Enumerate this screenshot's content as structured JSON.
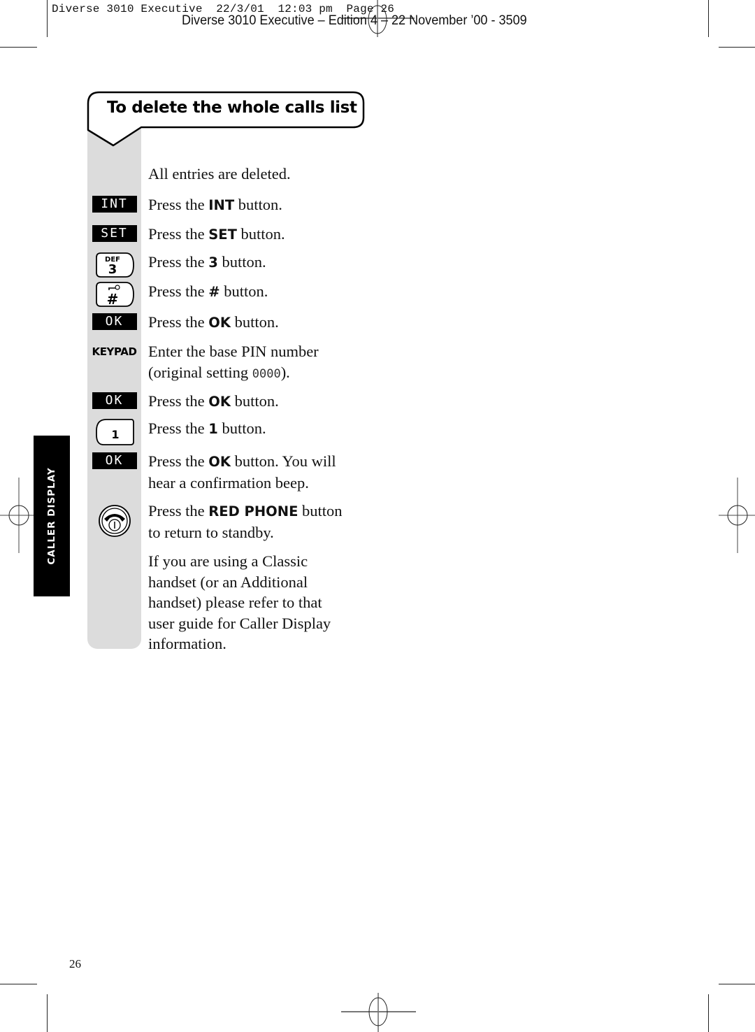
{
  "header": {
    "slug": "Diverse 3010 Executive  22/3/01  12:03 pm  Page 26",
    "edition": "Diverse 3010 Executive – Edition 4 – 22 November ’00 - 3509"
  },
  "section": {
    "title": "To delete the whole calls list",
    "side_tab": "CALLER DISPLAY"
  },
  "steps": [
    {
      "icon": "none",
      "text": "All entries are deleted."
    },
    {
      "icon": "lcd-key",
      "icon_label": "INT",
      "pre": "Press the ",
      "bold": "INT",
      "post": " button."
    },
    {
      "icon": "lcd-key",
      "icon_label": "SET",
      "pre": "Press the ",
      "bold": "SET",
      "post": " button."
    },
    {
      "icon": "keypad-key",
      "icon_label": "3",
      "icon_sub": "DEF",
      "pre": "Press the ",
      "bold": "3",
      "post": " button."
    },
    {
      "icon": "keypad-key",
      "icon_label": "#",
      "icon_sub": "key",
      "pre": "Press the ",
      "bold": "#",
      "post": " button."
    },
    {
      "icon": "lcd-key",
      "icon_label": "OK",
      "pre": "Press the ",
      "bold": "OK",
      "post": " button."
    },
    {
      "icon": "text-label",
      "icon_label": "KEYPAD",
      "line1": "Enter the base PIN number",
      "line2_pre": "(original setting ",
      "line2_lcd": "0000",
      "line2_post": ")."
    },
    {
      "icon": "lcd-key",
      "icon_label": "OK",
      "pre": "Press the ",
      "bold": "OK",
      "post": " button."
    },
    {
      "icon": "keypad-key",
      "icon_label": "1",
      "pre": "Press the ",
      "bold": "1",
      "post": " button."
    },
    {
      "icon": "lcd-key",
      "icon_label": "OK",
      "pre": "Press the ",
      "bold": "OK",
      "post": " button. You will",
      "line2": "hear a confirmation beep."
    },
    {
      "icon": "red-phone",
      "pre": "Press the ",
      "bold": "RED PHONE",
      "post": " button",
      "line2": "to return to standby."
    },
    {
      "icon": "none",
      "lines": [
        "If you are using a Classic",
        "handset (or an Additional",
        "handset) please refer to that",
        "user guide for Caller Display",
        "information."
      ]
    }
  ],
  "footer": {
    "page_number": "26"
  }
}
